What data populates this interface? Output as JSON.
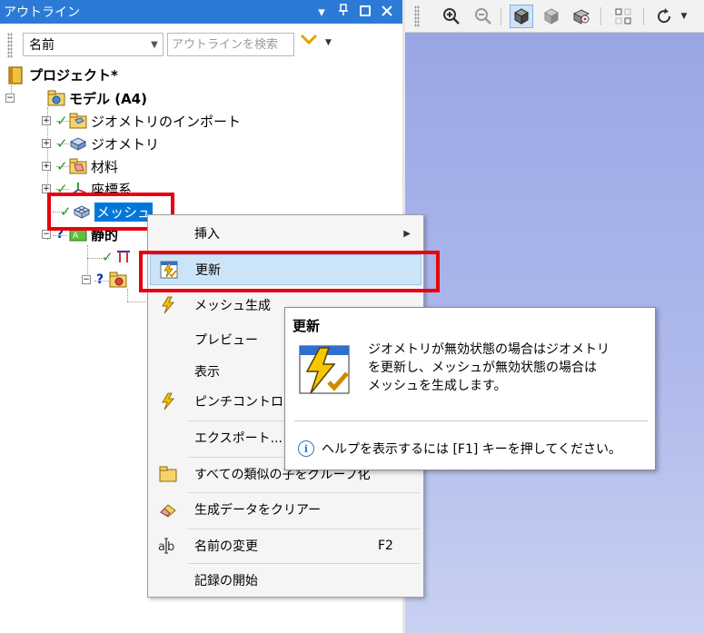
{
  "outline": {
    "title": "アウトライン",
    "controls": [
      "▼",
      "📌",
      "☐",
      "✕"
    ]
  },
  "filter": {
    "name_combo": "名前",
    "search_placeholder": "アウトラインを検索"
  },
  "tree": {
    "project": "プロジェクト*",
    "model": "モデル (A4)",
    "geometry_import": "ジオメトリのインポート",
    "geometry": "ジオメトリ",
    "materials": "材料",
    "coord_sys": "座標系",
    "mesh": "メッシュ",
    "static": "静的"
  },
  "context_menu": {
    "insert": "挿入",
    "update": "更新",
    "generate_mesh": "メッシュ生成",
    "preview": "プレビュー",
    "show": "表示",
    "pinch": "ピンチコントロー",
    "export": "エクスポート...",
    "group_similar": "すべての類似の子をグループ化",
    "clear_data": "生成データをクリアー",
    "rename": "名前の変更",
    "rename_key": "F2",
    "start_record": "記録の開始"
  },
  "tooltip": {
    "title": "更新",
    "line1": "ジオメトリが無効状態の場合はジオメトリ",
    "line2": "を更新し、メッシュが無効状態の場合は",
    "line3": "メッシュを生成します。",
    "help": "ヘルプを表示するには [F1] キーを押してください。"
  },
  "colors": {
    "titlebar": "#2b7bd6",
    "selection": "#0078d7",
    "highlight": "#e8000b",
    "viewport": "#aeb9eb"
  }
}
